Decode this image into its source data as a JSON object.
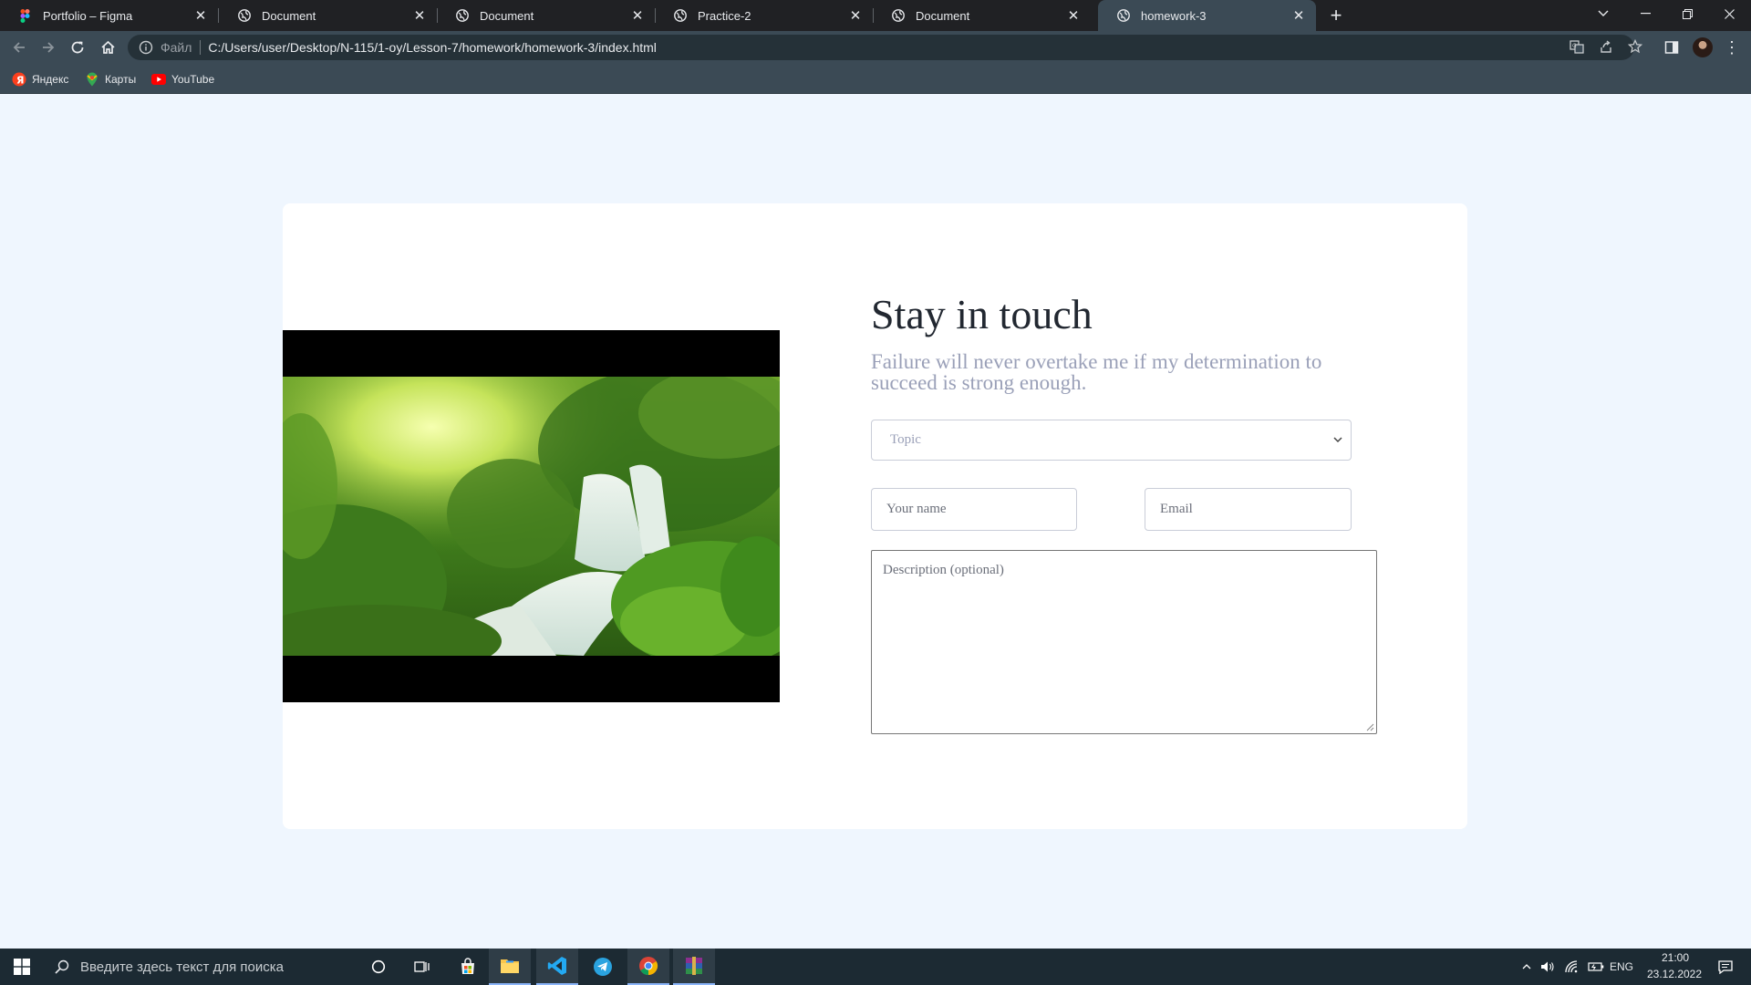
{
  "browser": {
    "tabs": [
      {
        "title": "Portfolio – Figma",
        "icon": "figma-icon",
        "active": false
      },
      {
        "title": "Document",
        "icon": "globe-icon",
        "active": false
      },
      {
        "title": "Document",
        "icon": "globe-icon",
        "active": false
      },
      {
        "title": "Practice-2",
        "icon": "globe-icon",
        "active": false
      },
      {
        "title": "Document",
        "icon": "globe-icon",
        "active": false
      },
      {
        "title": "homework-3",
        "icon": "globe-icon",
        "active": true
      }
    ],
    "address": {
      "scheme_label": "Файл",
      "url": "C:/Users/user/Desktop/N-115/1-oy/Lesson-7/homework/homework-3/index.html"
    },
    "bookmarks": [
      {
        "label": "Яндекс",
        "icon": "yandex-icon"
      },
      {
        "label": "Карты",
        "icon": "maps-pin-icon"
      },
      {
        "label": "YouTube",
        "icon": "youtube-icon"
      }
    ],
    "accent_color": "#3b4a55"
  },
  "page": {
    "heading": "Stay in touch",
    "subtitle": "Failure will never overtake me if my determination to succeed is strong enough.",
    "form": {
      "topic_selected": "Topic",
      "name_placeholder": "Your name",
      "email_placeholder": "Email",
      "description_placeholder": "Description (optional)"
    },
    "background_color": "#eff6fe",
    "image": "waterfall-forest-image"
  },
  "taskbar": {
    "search_placeholder": "Введите здесь текст для поиска",
    "language": "ENG",
    "time": "21:00",
    "date": "23.12.2022"
  }
}
